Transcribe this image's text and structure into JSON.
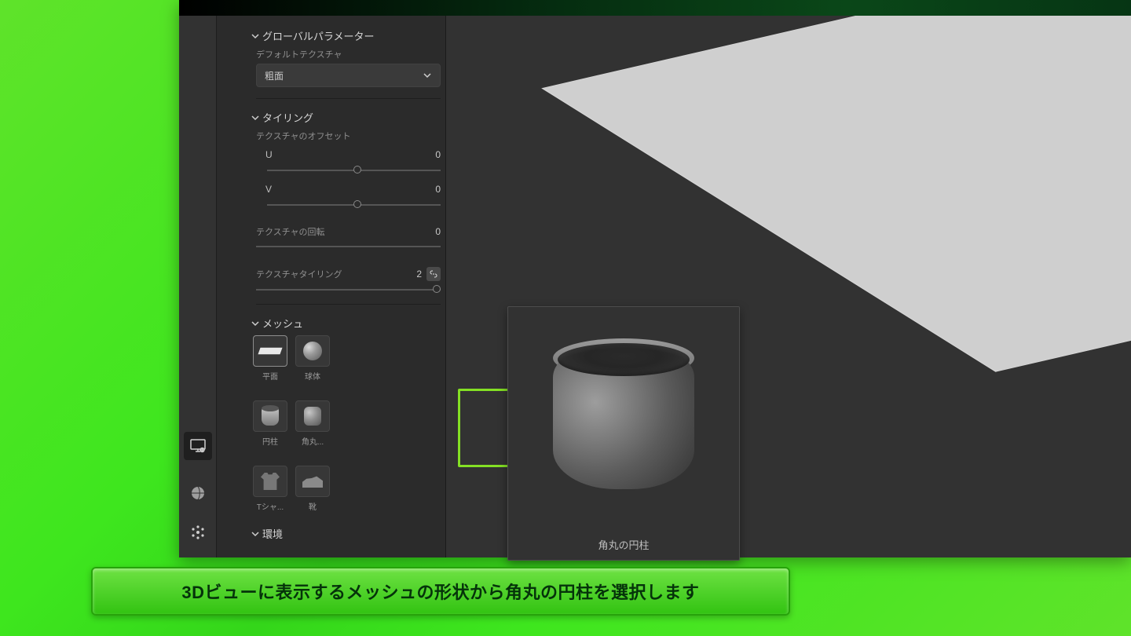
{
  "sections": {
    "global_params": {
      "title": "グローバルパラメーター",
      "default_texture_label": "デフォルトテクスチャ",
      "default_texture_value": "粗面"
    },
    "tiling": {
      "title": "タイリング",
      "offset_label": "テクスチャのオフセット",
      "u_label": "U",
      "u_value": "0",
      "v_label": "V",
      "v_value": "0",
      "rotation_label": "テクスチャの回転",
      "rotation_value": "0",
      "tiling_label": "テクスチャタイリング",
      "tiling_value": "2"
    },
    "mesh": {
      "title": "メッシュ"
    },
    "environment": {
      "title": "環境"
    }
  },
  "mesh_items": {
    "plane": "平面",
    "sphere": "球体",
    "cylinder": "円柱",
    "rounded_cylinder": "角丸...",
    "tshirt": "Tシャ...",
    "shoe": "靴"
  },
  "popover": {
    "caption": "角丸の円柱"
  },
  "caption": "3Dビューに表示するメッシュの形状から角丸の円柱を選択します"
}
